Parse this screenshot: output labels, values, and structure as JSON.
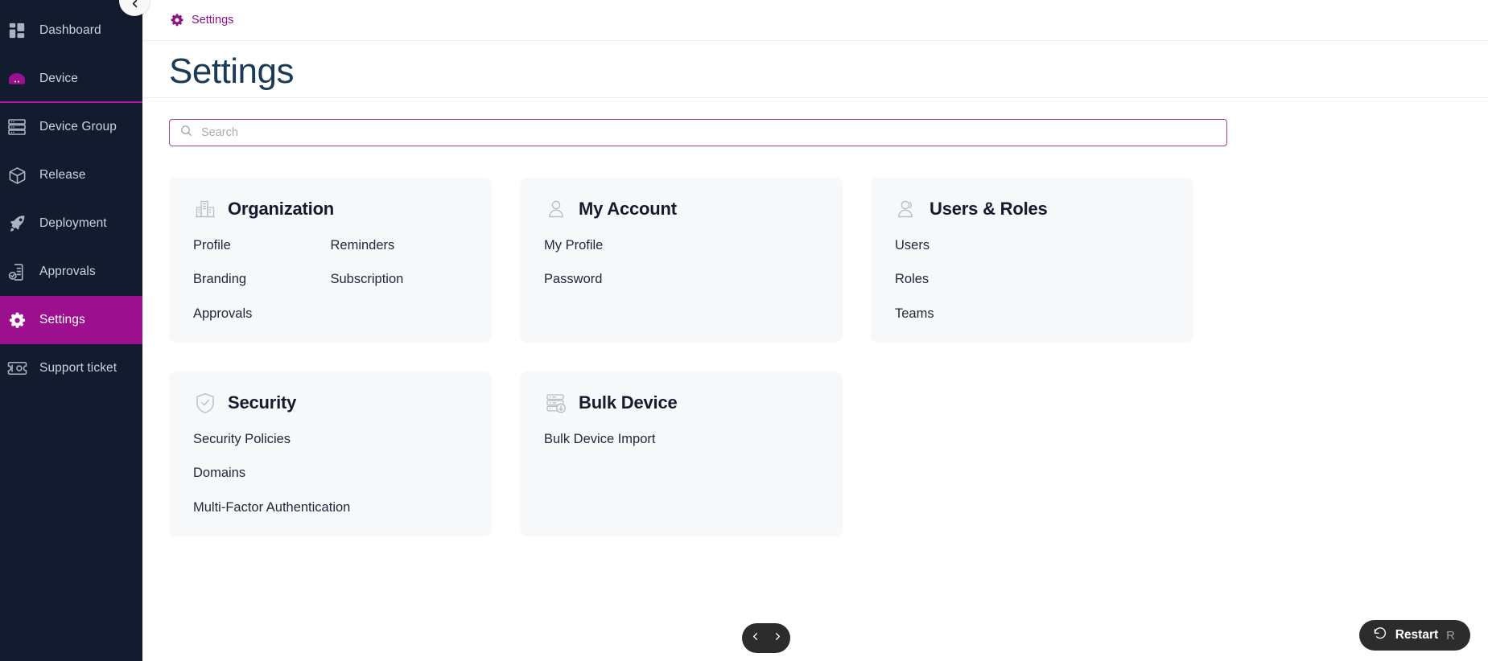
{
  "sidebar": {
    "collapse_icon": "chevron-left-icon",
    "items": [
      {
        "label": "Dashboard",
        "icon": "dashboard-icon",
        "active": false
      },
      {
        "label": "Device",
        "icon": "device-icon",
        "active": false
      },
      {
        "label": "Device Group",
        "icon": "device-group-icon",
        "active": false
      },
      {
        "label": "Release",
        "icon": "release-box-icon",
        "active": false
      },
      {
        "label": "Deployment",
        "icon": "rocket-icon",
        "active": false
      },
      {
        "label": "Approvals",
        "icon": "approvals-icon",
        "active": false
      },
      {
        "label": "Settings",
        "icon": "gear-icon",
        "active": true
      },
      {
        "label": "Support ticket",
        "icon": "ticket-icon",
        "active": false
      }
    ]
  },
  "breadcrumb": {
    "icon": "gear-icon",
    "label": "Settings"
  },
  "page": {
    "title": "Settings"
  },
  "search": {
    "icon": "search-icon",
    "placeholder": "Search",
    "value": ""
  },
  "cards": [
    {
      "title": "Organization",
      "icon": "building-icon",
      "columns": 2,
      "links": [
        "Profile",
        "Reminders",
        "Branding",
        "Subscription",
        "Approvals"
      ]
    },
    {
      "title": "My Account",
      "icon": "user-icon",
      "columns": 1,
      "links": [
        "My Profile",
        "Password"
      ]
    },
    {
      "title": "Users & Roles",
      "icon": "users-icon",
      "columns": 1,
      "links": [
        "Users",
        "Roles",
        "Teams"
      ]
    },
    {
      "title": "Security",
      "icon": "shield-check-icon",
      "columns": 1,
      "links": [
        "Security Policies",
        "Domains",
        "Multi-Factor Authentication"
      ]
    },
    {
      "title": "Bulk Device",
      "icon": "server-import-icon",
      "columns": 1,
      "links": [
        "Bulk Device Import"
      ]
    }
  ],
  "pager": {
    "prev_icon": "chevron-left-icon",
    "next_icon": "chevron-right-icon"
  },
  "restart": {
    "icon": "restart-icon",
    "label": "Restart",
    "shortcut": "R"
  },
  "colors": {
    "sidebar_bg": "#131c2e",
    "accent_magenta": "#9c0f8f",
    "breadcrumb_text": "#8d1189",
    "title_navy": "#1b3a56",
    "card_bg": "#f7f8fa",
    "pill_dark": "#2c2c2c"
  }
}
